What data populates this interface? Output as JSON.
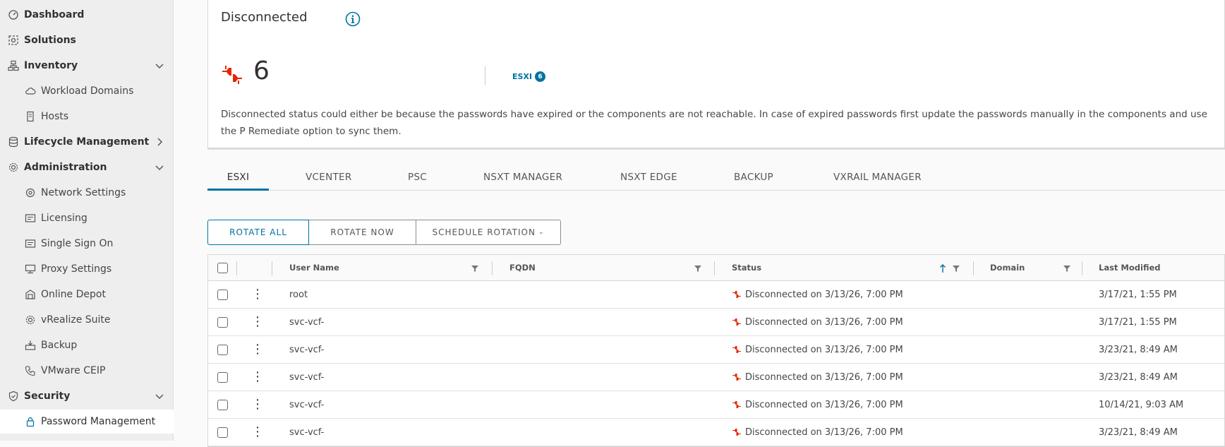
{
  "sidebar": {
    "items": [
      {
        "label": "Dashboard",
        "icon": "dashboard-icon",
        "level": "top"
      },
      {
        "label": "Solutions",
        "icon": "solutions-icon",
        "level": "top"
      },
      {
        "label": "Inventory",
        "icon": "inventory-icon",
        "level": "top",
        "chevron": "down"
      },
      {
        "label": "Workload Domains",
        "icon": "cloud-icon",
        "level": "sub"
      },
      {
        "label": "Hosts",
        "icon": "host-icon",
        "level": "sub"
      },
      {
        "label": "Lifecycle Management",
        "icon": "database-icon",
        "level": "top",
        "chevron": "right"
      },
      {
        "label": "Administration",
        "icon": "gear-icon",
        "level": "top",
        "chevron": "down"
      },
      {
        "label": "Network Settings",
        "icon": "network-icon",
        "level": "sub"
      },
      {
        "label": "Licensing",
        "icon": "license-icon",
        "level": "sub"
      },
      {
        "label": "Single Sign On",
        "icon": "sso-icon",
        "level": "sub"
      },
      {
        "label": "Proxy Settings",
        "icon": "proxy-icon",
        "level": "sub"
      },
      {
        "label": "Online Depot",
        "icon": "depot-icon",
        "level": "sub"
      },
      {
        "label": "vRealize Suite",
        "icon": "gear-icon",
        "level": "sub"
      },
      {
        "label": "Backup",
        "icon": "backup-icon",
        "level": "sub"
      },
      {
        "label": "VMware CEIP",
        "icon": "phone-icon",
        "level": "sub"
      },
      {
        "label": "Security",
        "icon": "shield-icon",
        "level": "top",
        "chevron": "down"
      },
      {
        "label": "Password Management",
        "icon": "lock-icon",
        "level": "sub",
        "active": true
      }
    ]
  },
  "card": {
    "title": "Disconnected",
    "count": "6",
    "esxi_label": "ESXI",
    "esxi_badge": "6",
    "description": "Disconnected status could either be because the passwords have expired or the components are not reachable. In case of expired passwords first update the passwords manually in the components and use the P Remediate option to sync them."
  },
  "tabs": [
    "ESXI",
    "VCENTER",
    "PSC",
    "NSXT MANAGER",
    "NSXT EDGE",
    "BACKUP",
    "VXRAIL MANAGER"
  ],
  "buttons": {
    "rotate_all": "ROTATE ALL",
    "rotate_now": "ROTATE NOW",
    "schedule_rotation": "SCHEDULE ROTATION"
  },
  "table": {
    "columns": {
      "user_name": "User Name",
      "fqdn": "FQDN",
      "status": "Status",
      "domain": "Domain",
      "last_modified": "Last Modified"
    },
    "rows": [
      {
        "user": "root",
        "status": "Disconnected on 3/13/26, 7:00 PM",
        "modified": "3/17/21, 1:55 PM"
      },
      {
        "user": "svc-vcf-",
        "status": "Disconnected on 3/13/26, 7:00 PM",
        "modified": "3/17/21, 1:55 PM"
      },
      {
        "user": "svc-vcf-",
        "status": "Disconnected on 3/13/26, 7:00 PM",
        "modified": "3/23/21, 8:49 AM"
      },
      {
        "user": "svc-vcf-",
        "status": "Disconnected on 3/13/26, 7:00 PM",
        "modified": "3/23/21, 8:49 AM"
      },
      {
        "user": "svc-vcf-",
        "status": "Disconnected on 3/13/26, 7:00 PM",
        "modified": "10/14/21, 9:03 AM"
      },
      {
        "user": "svc-vcf-",
        "status": "Disconnected on 3/13/26, 7:00 PM",
        "modified": "3/23/21, 8:49 AM"
      }
    ]
  },
  "colors": {
    "accent": "#0072a3",
    "disconnected": "#e62700"
  }
}
